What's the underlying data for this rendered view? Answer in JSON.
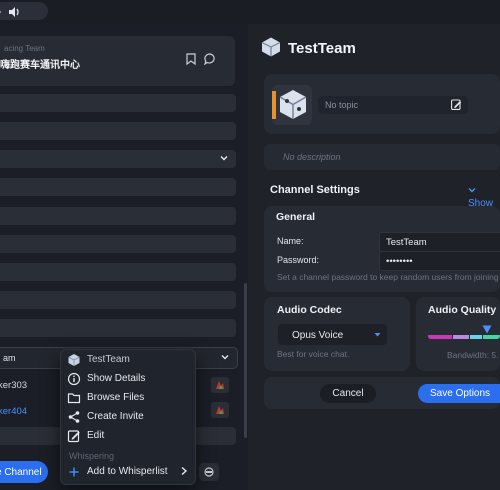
{
  "server": {
    "subtitle": "acing Team",
    "name": "嗨跑赛车通讯中心"
  },
  "channel_tree": {
    "team_row_label": "am",
    "users": [
      {
        "name": "ker303",
        "color": "#d6dae2"
      },
      {
        "name": "ker404",
        "color": "#4a90ff"
      }
    ],
    "create_channel_label": "e Channel"
  },
  "context_menu": {
    "title": "TestTeam",
    "items": [
      {
        "label": "Show Details",
        "icon": "info-icon"
      },
      {
        "label": "Browse Files",
        "icon": "folder-icon"
      },
      {
        "label": "Create Invite",
        "icon": "share-icon"
      },
      {
        "label": "Edit",
        "icon": "edit-icon"
      }
    ],
    "section_label": "Whispering",
    "whisper_item": {
      "label": "Add to Whisperlist",
      "icon": "plus-icon"
    }
  },
  "channel": {
    "title": "TestTeam",
    "topic_placeholder": "No topic",
    "description_placeholder": "No description"
  },
  "settings": {
    "title": "Channel Settings",
    "show_toggle": "Show",
    "general": {
      "title": "General",
      "name_label": "Name:",
      "name_value": "TestTeam",
      "password_label": "Password:",
      "password_value": "••••••••",
      "password_hint": "Set a channel password to keep random users from joining"
    },
    "audio_codec": {
      "title": "Audio Codec",
      "selected": "Opus Voice",
      "hint": "Best for voice chat."
    },
    "audio_quality": {
      "title": "Audio Quality",
      "level": 0.78,
      "bandwidth_text": "Bandwidth: 5."
    }
  },
  "actions": {
    "cancel_label": "Cancel",
    "save_label": "Save Options"
  },
  "colors": {
    "accent": "#2b6ff0",
    "link": "#4a90ff",
    "panel": "#272b34",
    "background": "#1b1e26"
  }
}
